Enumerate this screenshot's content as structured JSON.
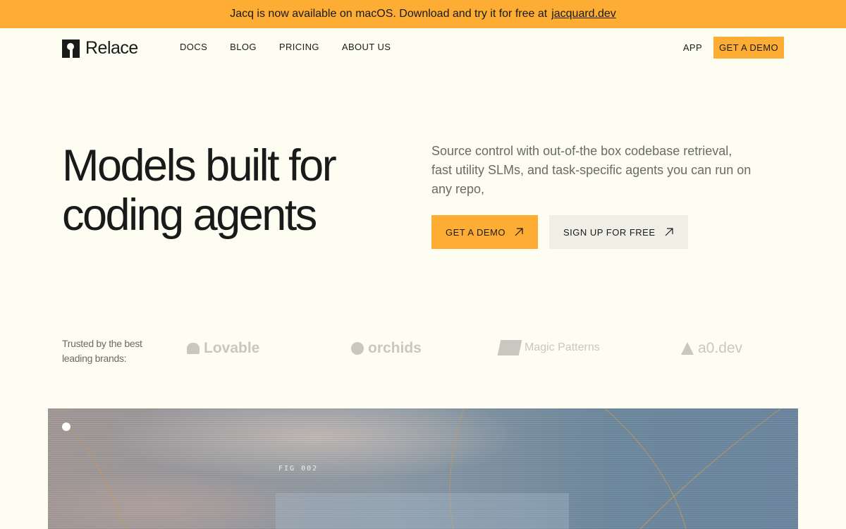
{
  "banner": {
    "text": "Jacq is now available on macOS. Download and try it for free at",
    "link": "jacquard.dev"
  },
  "nav": {
    "logo_text": "Relace",
    "links": [
      "DOCS",
      "BLOG",
      "PRICING",
      "ABOUT US"
    ],
    "app": "APP",
    "demo": "GET A DEMO"
  },
  "hero": {
    "headline_line1": "Models built for",
    "headline_line2": "coding agents",
    "subtitle": "Source control with out-of-the box codebase retrieval, fast utility SLMs, and task-specific agents you can run on any repo,",
    "cta_primary": "GET A DEMO",
    "cta_secondary": "SIGN UP FOR FREE"
  },
  "trusted": {
    "text": "Trusted by the best leading brands:",
    "brands": [
      "Lovable",
      "orchids",
      "Magic Patterns",
      "a0.dev"
    ]
  },
  "figure": {
    "label": "FIG  002"
  },
  "colors": {
    "accent": "#fdad33",
    "background": "#fefdf1",
    "muted_text": "#6b6b66"
  },
  "icons": {
    "arrow": "arrow-up-right-icon"
  }
}
